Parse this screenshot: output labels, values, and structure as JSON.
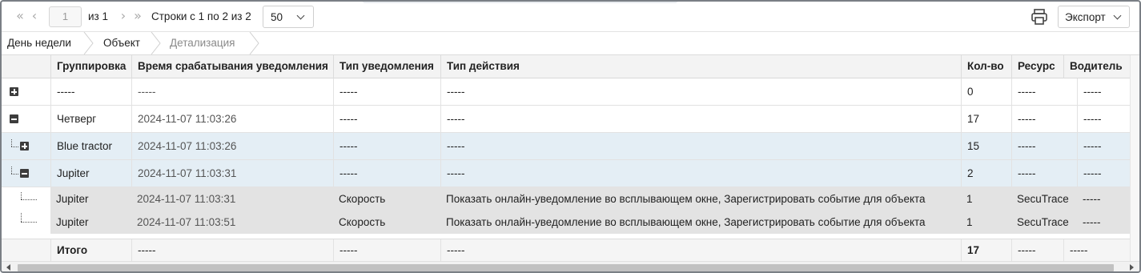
{
  "toolbar": {
    "first_icon": "«",
    "prev_icon": "‹",
    "page_value": "1",
    "of_label": "из 1",
    "next_icon": "›",
    "last_icon": "»",
    "rows_label": "Строки с 1 по 2 из 2",
    "page_size": "50",
    "export_label": "Экспорт"
  },
  "breadcrumbs": [
    "День недели",
    "Объект",
    "Детализация"
  ],
  "columns": [
    "Группировка",
    "Время срабатывания уведомления",
    "Тип уведомления",
    "Тип действия",
    "Кол-во",
    "Ресурс",
    "Водитель"
  ],
  "rows": [
    {
      "group": "-----",
      "time": "-----",
      "ntype": "-----",
      "action": "-----",
      "count": "0",
      "resource": "-----",
      "driver": "-----"
    },
    {
      "group": "Четверг",
      "time": "2024-11-07 11:03:26",
      "ntype": "-----",
      "action": "-----",
      "count": "17",
      "resource": "-----",
      "driver": "-----"
    },
    {
      "group": "Blue tractor",
      "time": "2024-11-07 11:03:26",
      "ntype": "-----",
      "action": "-----",
      "count": "15",
      "resource": "-----",
      "driver": "-----"
    },
    {
      "group": "Jupiter",
      "time": "2024-11-07 11:03:31",
      "ntype": "-----",
      "action": "-----",
      "count": "2",
      "resource": "-----",
      "driver": "-----"
    },
    {
      "group": "Jupiter",
      "time": "2024-11-07 11:03:31",
      "ntype": "Скорость",
      "action": "Показать онлайн-уведомление во всплывающем окне, Зарегистрировать событие для объекта",
      "count": "1",
      "resource": "SecuTrace",
      "driver": "-----"
    },
    {
      "group": "Jupiter",
      "time": "2024-11-07 11:03:51",
      "ntype": "Скорость",
      "action": "Показать онлайн-уведомление во всплывающем окне, Зарегистрировать событие для объекта",
      "count": "1",
      "resource": "SecuTrace",
      "driver": "-----"
    }
  ],
  "total": {
    "group": "Итого",
    "time": "-----",
    "ntype": "-----",
    "action": "-----",
    "count": "17",
    "resource": "-----",
    "driver": "-----"
  },
  "colors": {
    "selected_row": "#e4eef5",
    "detail_row": "#e3e3e3",
    "header": "#f3f3f3"
  }
}
